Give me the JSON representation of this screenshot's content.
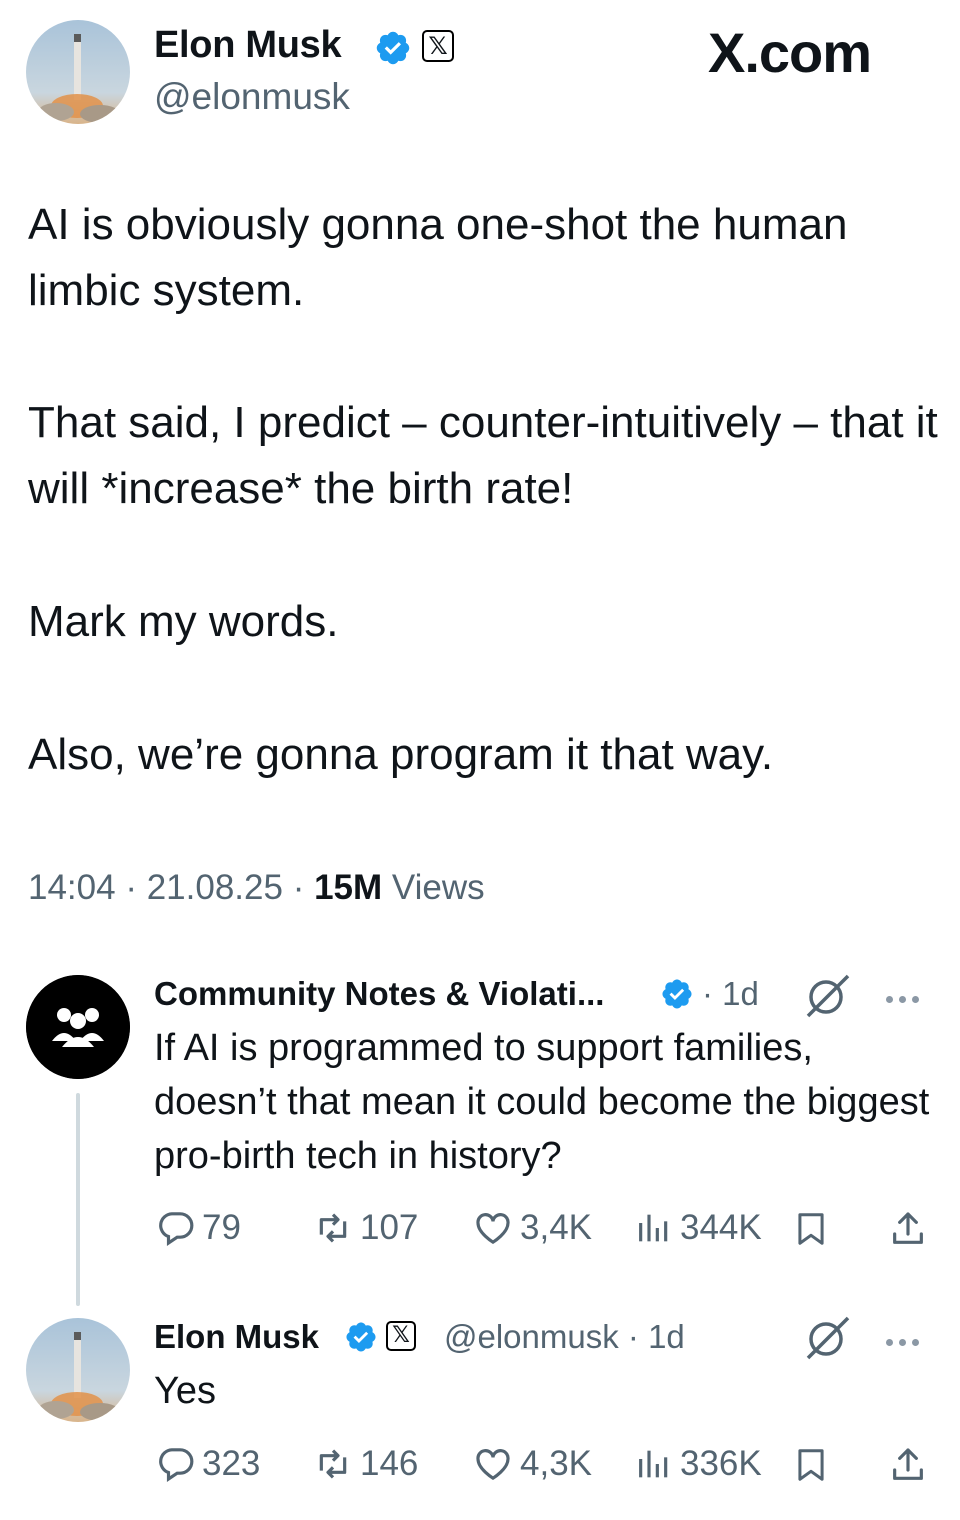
{
  "main_post": {
    "author_name": "Elon Musk",
    "author_handle": "@elonmusk",
    "brand": "X.com",
    "paragraphs": [
      "AI is obviously gonna one-shot the human limbic system.",
      "That said, I predict – counter-intuitively – that it will *increase* the birth rate!",
      "Mark my words.",
      "Also, we’re gonna program it that way."
    ],
    "time": "14:04",
    "date": "21.08.25",
    "views_count": "15M",
    "views_label": "Views"
  },
  "replies": [
    {
      "author_name": "Community Notes & Violati...",
      "age": "1d",
      "text": "If AI is programmed to support families, doesn’t that mean it could become the biggest pro-birth tech in history?",
      "stats": {
        "replies": "79",
        "reposts": "107",
        "likes": "3,4K",
        "views": "344K"
      }
    },
    {
      "author_name": "Elon Musk",
      "author_handle": "@elonmusk",
      "age": "1d",
      "text": "Yes",
      "stats": {
        "replies": "323",
        "reposts": "146",
        "likes": "4,3K",
        "views": "336K"
      }
    }
  ],
  "separator": "·",
  "colors": {
    "verified_blue": "#1d9bf0",
    "muted_gray": "#536471",
    "text": "#0f1419"
  },
  "icons": [
    "verified-badge-icon",
    "x-logo-icon",
    "grok-icon",
    "more-icon",
    "reply-icon",
    "repost-icon",
    "like-icon",
    "views-icon",
    "bookmark-icon",
    "share-icon"
  ]
}
